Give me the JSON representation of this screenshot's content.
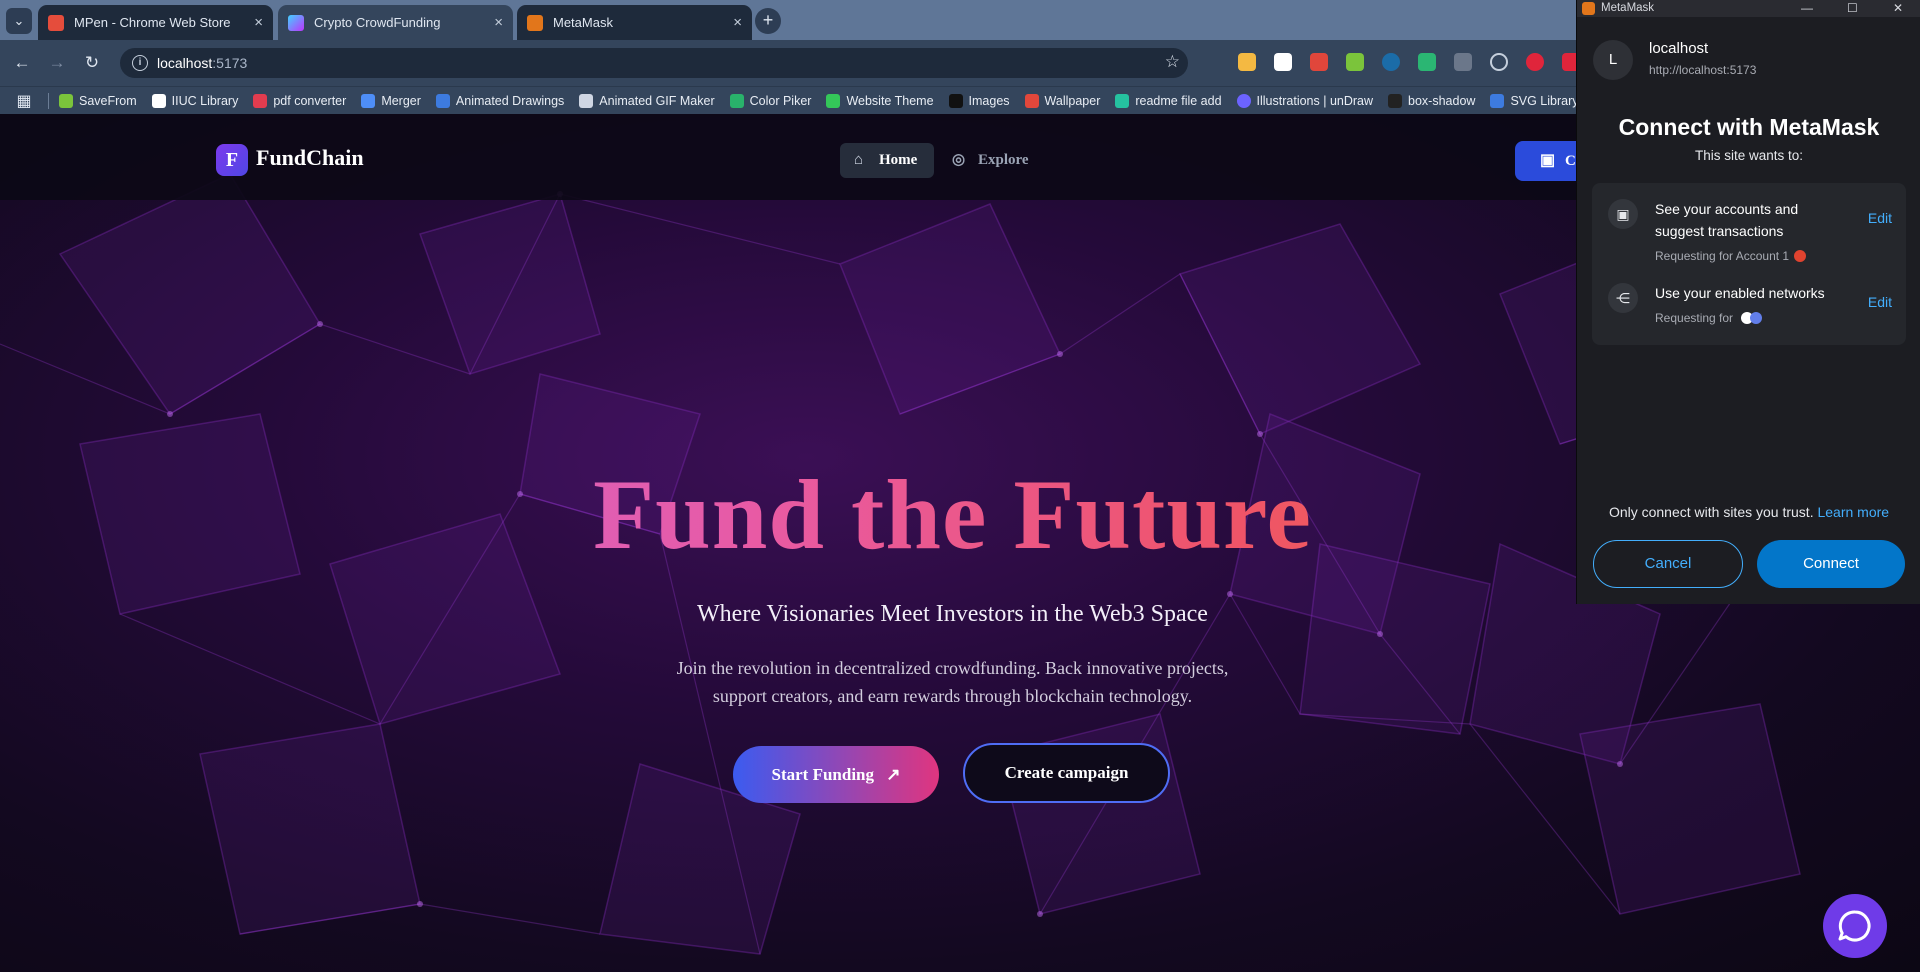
{
  "browser": {
    "tabs": [
      {
        "title": "MPen - Chrome Web Store",
        "icon": "chrome-web-store-icon",
        "color": "#e54d3c"
      },
      {
        "title": "Crypto CrowdFunding",
        "icon": "vite-icon",
        "color": "#a374f7"
      },
      {
        "title": "MetaMask",
        "icon": "metamask-fox-icon",
        "color": "#e2761b"
      }
    ],
    "url_host": "localhost",
    "url_port": ":5173",
    "bookmarks": [
      {
        "label": "SaveFrom",
        "color": "#7bc43b"
      },
      {
        "label": "IIUC Library",
        "color": "#ffffff"
      },
      {
        "label": "pdf converter",
        "color": "#e23c4f"
      },
      {
        "label": "Merger",
        "color": "#4e8ef7"
      },
      {
        "label": "Animated Drawings",
        "color": "#3d7be0"
      },
      {
        "label": "Animated GIF Maker",
        "color": "#cfd6e3"
      },
      {
        "label": "Color Piker",
        "color": "#29b26b"
      },
      {
        "label": "Website Theme",
        "color": "#34c759"
      },
      {
        "label": "Images",
        "color": "#111111"
      },
      {
        "label": "Wallpaper",
        "color": "#e2473b"
      },
      {
        "label": "readme file add",
        "color": "#25c2a0"
      },
      {
        "label": "Illustrations | unDraw",
        "color": "#6c63ff"
      },
      {
        "label": "box-shadow",
        "color": "#222222"
      },
      {
        "label": "SVG Library",
        "color": "#3d7be0"
      }
    ]
  },
  "site": {
    "brand_letter": "F",
    "brand": "FundChain",
    "nav": {
      "home": "Home",
      "explore": "Explore"
    },
    "connect_label": "C",
    "hero": {
      "title": "Fund the Future",
      "subtitle": "Where Visionaries Meet Investors in the Web3 Space",
      "desc_line1": "Join the revolution in decentralized crowdfunding. Back innovative projects,",
      "desc_line2": "support creators, and earn rewards through blockchain technology.",
      "start_label": "Start Funding",
      "create_label": "Create campaign"
    },
    "colors": {
      "accent": "#2b4bdb",
      "brand_purple": "#7c3aed",
      "gradient_start": "#c56be6",
      "gradient_end": "#f17a30"
    }
  },
  "metamask": {
    "window_title": "MetaMask",
    "site_initial": "L",
    "site_host": "localhost",
    "site_url": "http://localhost:5173",
    "heading": "Connect with MetaMask",
    "wants": "This site wants to:",
    "perm1_title": "See your accounts and suggest transactions",
    "perm1_sub": "Requesting for Account 1",
    "perm2_title": "Use your enabled networks",
    "perm2_sub": "Requesting for",
    "edit_label": "Edit",
    "trust_text": "Only connect with sites you trust.",
    "learn_more": "Learn more",
    "cancel_label": "Cancel",
    "connect_label": "Connect",
    "colors": {
      "link": "#43aefc",
      "primary": "#0376c9"
    }
  }
}
